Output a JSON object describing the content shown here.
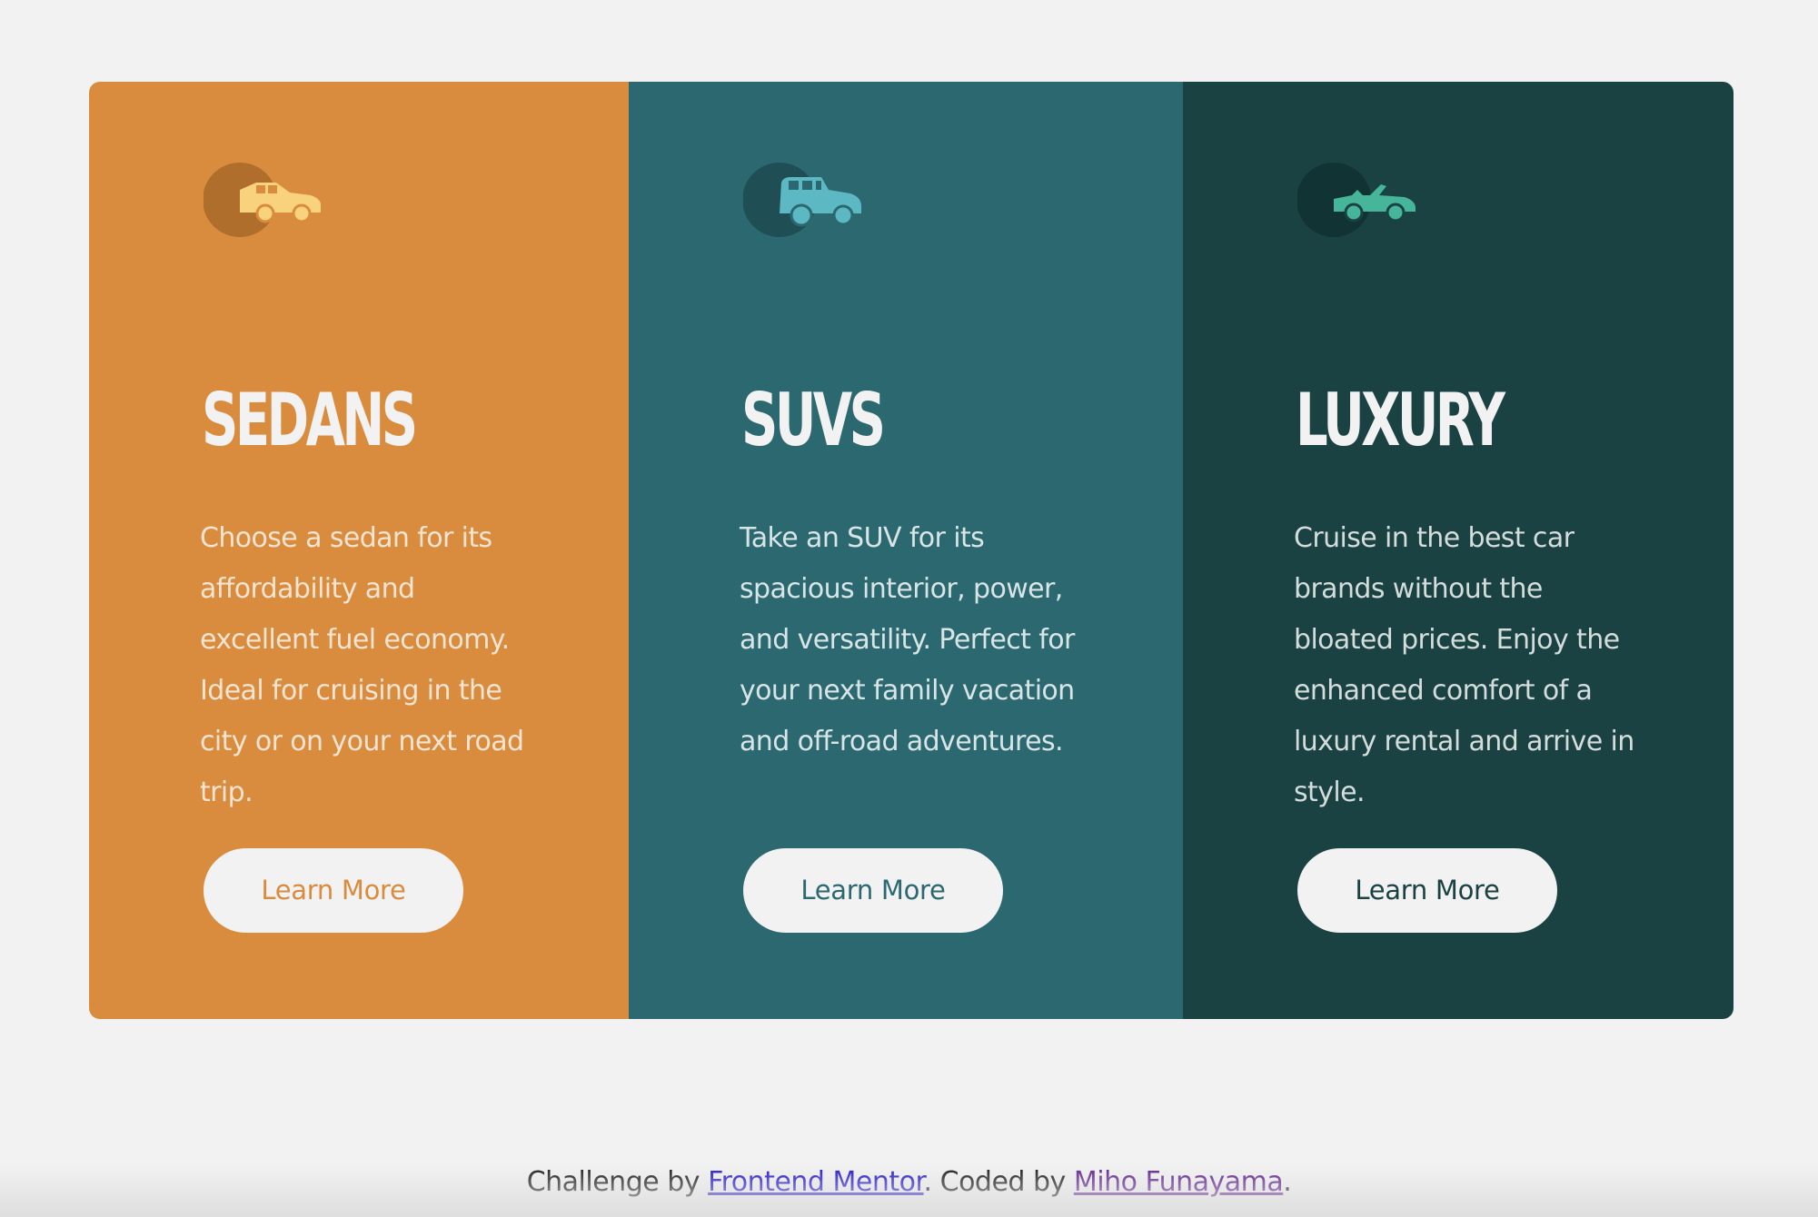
{
  "colors": {
    "page_bg": "#f2f2f2",
    "sedans_bg": "#d98c3d",
    "suvs_bg": "#2b6870",
    "luxury_bg": "#1a4242",
    "button_bg": "#f2f2f2",
    "title_text": "#f2f2f2"
  },
  "cards": [
    {
      "icon": "sedan-car-icon",
      "title": "SEDANS",
      "description": "Choose a sedan for its affordability and excellent fuel economy. Ideal for cruising in the city or on your next road trip.",
      "button_label": "Learn More"
    },
    {
      "icon": "suv-car-icon",
      "title": "SUVS",
      "description": "Take an SUV for its spacious interior, power, and versatility. Perfect for your next family vacation and off-road adventures.",
      "button_label": "Learn More"
    },
    {
      "icon": "luxury-convertible-icon",
      "title": "LUXURY",
      "description": "Cruise in the best car brands without the bloated prices. Enjoy the enhanced comfort of a luxury rental and arrive in style.",
      "button_label": "Learn More"
    }
  ],
  "footer": {
    "challenge_prefix": "Challenge by ",
    "challenge_link": "Frontend Mentor",
    "coded_prefix": ". Coded by ",
    "author_link": "Miho Funayama",
    "suffix": "."
  }
}
